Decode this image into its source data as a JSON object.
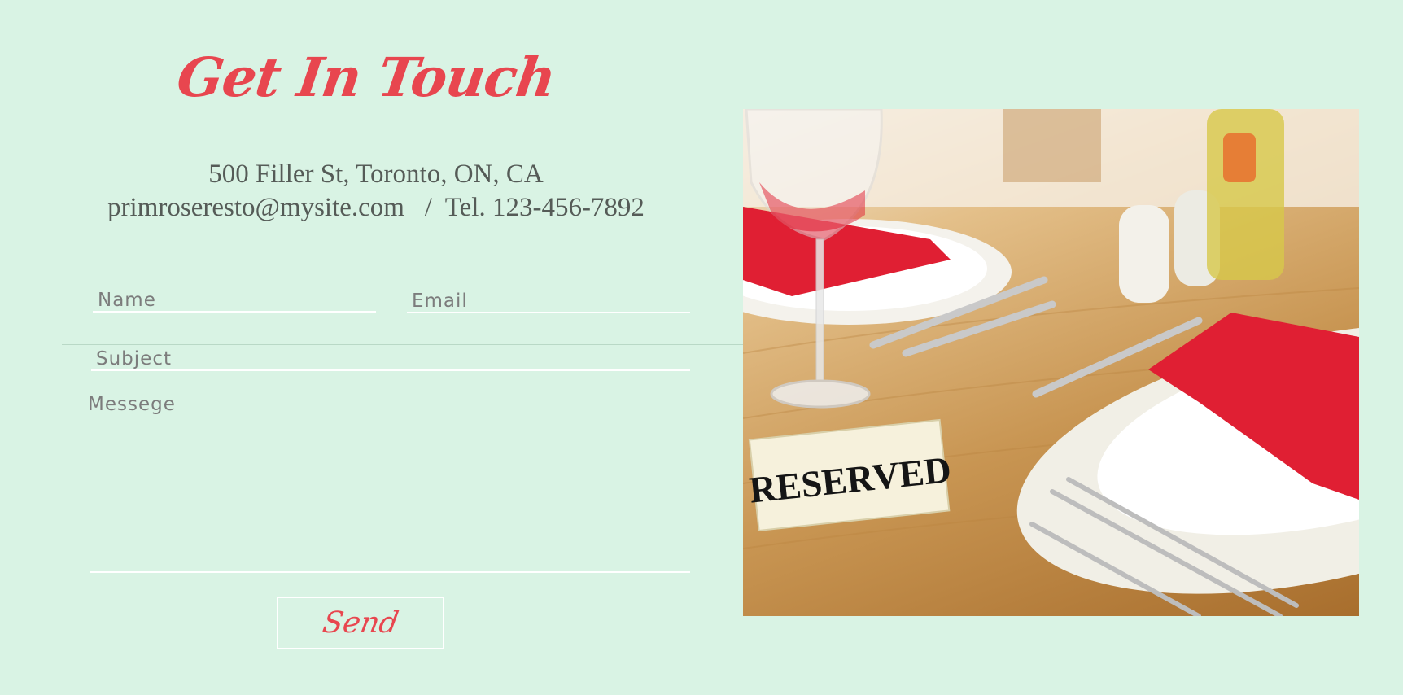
{
  "heading": "Get In Touch",
  "contact": {
    "address": "500 Filler St, Toronto, ON, CA",
    "email_tel": "primroseresto@mysite.com   /  Tel. 123-456-7892"
  },
  "form": {
    "name_placeholder": "Name",
    "email_placeholder": "Email",
    "subject_placeholder": "Subject",
    "message_placeholder": "Messege",
    "send_label": "Send"
  },
  "photo": {
    "sign_text": "RESERVED"
  },
  "colors": {
    "background": "#d9f3e4",
    "accent": "#e8464f",
    "text": "#555b57",
    "placeholder": "#7c7c7c",
    "napkin": "#e01f33"
  }
}
